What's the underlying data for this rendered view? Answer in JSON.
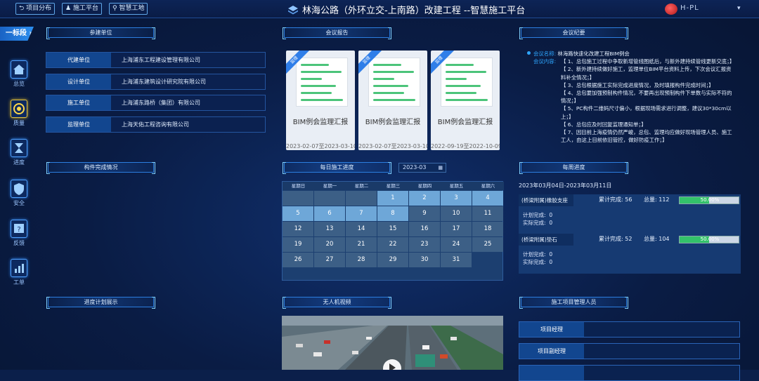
{
  "header": {
    "nav_buttons": [
      "项目分布",
      "施工平台",
      "智慧工地"
    ],
    "title": "林海公路（外环立交-上南路）改建工程 --智慧施工平台",
    "user_name": "H-PL"
  },
  "sidebar": {
    "section_label": "一标段",
    "items": [
      {
        "label": "总览",
        "icon": "home-icon"
      },
      {
        "label": "质量",
        "icon": "quality-badge-icon"
      },
      {
        "label": "进度",
        "icon": "hourglass-icon"
      },
      {
        "label": "安全",
        "icon": "shield-icon"
      },
      {
        "label": "反馈",
        "icon": "feedback-icon"
      },
      {
        "label": "工单",
        "icon": "chart-icon"
      }
    ]
  },
  "participants": {
    "title": "参建单位",
    "rows": [
      {
        "key": "代建单位",
        "value": "上海浦东工程建设管理有限公司"
      },
      {
        "key": "设计单位",
        "value": "上海浦东建筑设计研究院有限公司"
      },
      {
        "key": "施工单位",
        "value": "上海浦东路桥（集团）有限公司"
      },
      {
        "key": "监理单位",
        "value": "上海天佑工程咨询有限公司"
      }
    ]
  },
  "meeting_reports": {
    "title": "会议报告",
    "ribbon": "监理",
    "cards": [
      {
        "title": "BIM例会监理汇报",
        "date": "2023-02-07至2023-03-10"
      },
      {
        "title": "BIM例会监理汇报",
        "date": "2023-02-07至2023-03-10"
      },
      {
        "title": "BIM例会监理汇报",
        "date": "2022-09-19至2022-10-09"
      }
    ]
  },
  "meeting_minutes": {
    "title": "会议纪要",
    "name_label": "会议名称:",
    "name_value": "林海路快速化改建工程BIM例会",
    "content_label": "会议内容:",
    "items": [
      "【 1、总包施工过程中争取新增管线图纸后，与新外建持续管线更新交底；】",
      "【 2、新外建持续做好施工，监理单位BIM平台资料上传，下次会议汇报资料补全情况；】",
      "【 3、总包根据施工实际完成进度情况，及时填报构件完成时间；】",
      "【 4、总包要加强预制构件情况，不要再出现预制构件下单数与实际不符的情况；】",
      "【 5、PC构件二维码尺寸偏小，根据现场需求进行调整，建议30*30cm以上；】",
      "【 6、总包应及时回复监理通知单；】",
      "【 7、因目前上海疫情仍然严峻，总包、监理均应做好现场管理人员、施工工人，由这上目前依旧管控，做好防疫工作；】"
    ]
  },
  "component_progress": {
    "title": "构件完成情况"
  },
  "daily_progress": {
    "title": "每日施工进度",
    "month": "2023-03",
    "weekdays": [
      "星期日",
      "星期一",
      "星期二",
      "星期三",
      "星期四",
      "星期五",
      "星期六"
    ],
    "first_weekday": 3,
    "days_in_month": 31,
    "highlight_until": 8
  },
  "weekly_progress": {
    "title": "每周进度",
    "range": "2023年03月04日-2023年03月11日",
    "completed_label": "累计完成:",
    "total_label": "总量:",
    "plan_label": "计划完成:",
    "actual_label": "实际完成:",
    "items": [
      {
        "name": "(桥梁附属)橡胶支座",
        "completed": "56",
        "total": "112",
        "percent_text": "50.00%",
        "percent": 50,
        "plan": "0",
        "actual": "0"
      },
      {
        "name": "(桥梁附属)垫石",
        "completed": "52",
        "total": "104",
        "percent_text": "50.00%",
        "percent": 50,
        "plan": "0",
        "actual": "0"
      }
    ]
  },
  "schedule_display": {
    "title": "进度计划展示"
  },
  "drone_video": {
    "title": "无人机视频"
  },
  "management": {
    "title": "施工项目管理人员",
    "roles": [
      "项目经理",
      "项目副经理"
    ]
  }
}
